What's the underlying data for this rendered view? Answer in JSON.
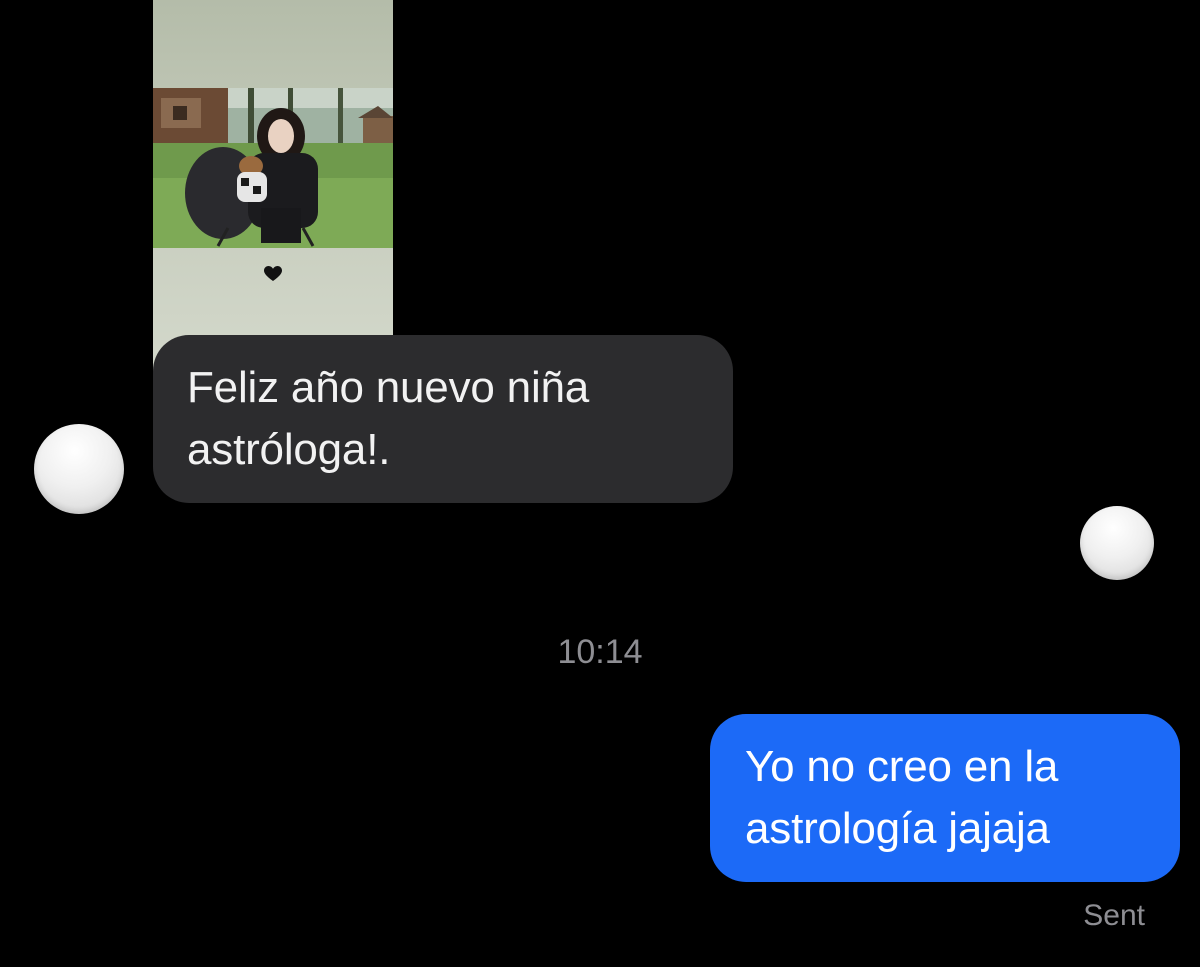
{
  "conversation": {
    "story_reply": {
      "photo_description_icon": "shared-photo",
      "heart_icon": "black-heart-icon"
    },
    "received_message": {
      "lines": [
        "Feliz año nuevo niña",
        "astróloga!."
      ]
    },
    "timestamp": "10:14",
    "sent_message": {
      "lines": [
        "Yo no creo en la",
        "astrología jajaja"
      ],
      "status": "Sent"
    }
  },
  "colors": {
    "background": "#000000",
    "received_bubble": "#2c2c2e",
    "sent_bubble": "#1c6af7",
    "meta_text": "#8e8e93"
  }
}
